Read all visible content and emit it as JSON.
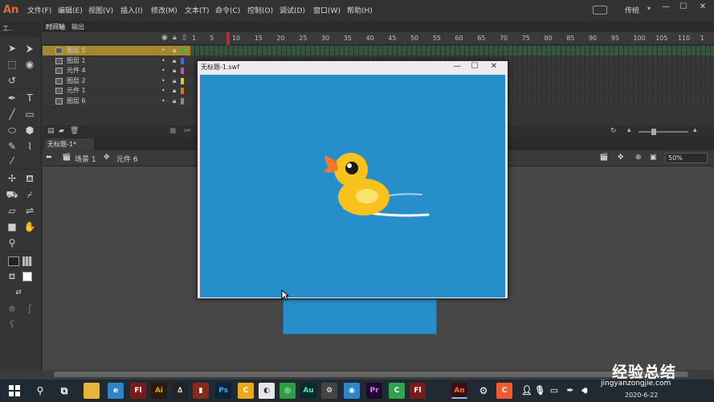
{
  "app": {
    "logo": "An",
    "workspace": "传统"
  },
  "menu": [
    "文件(F)",
    "编辑(E)",
    "视图(V)",
    "插入(I)",
    "修改(M)",
    "文本(T)",
    "命令(C)",
    "控制(O)",
    "调试(D)",
    "窗口(W)",
    "帮助(H)"
  ],
  "window_controls": [
    "—",
    "☐",
    "✕"
  ],
  "tools_header": "工..",
  "timeline": {
    "tabs": [
      "时间轴",
      "输出"
    ],
    "ruler": [
      "1",
      "5",
      "10",
      "15",
      "20",
      "25",
      "30",
      "35",
      "40",
      "45",
      "50",
      "55",
      "60",
      "65",
      "70",
      "75",
      "80",
      "85",
      "90",
      "95",
      "100",
      "105",
      "110",
      "1"
    ],
    "layers": [
      {
        "name": "图层 5",
        "color": "#2fb24e",
        "selected": true
      },
      {
        "name": "图层 1",
        "color": "#3a6fd8"
      },
      {
        "name": "元件 4",
        "color": "#c04fc0"
      },
      {
        "name": "图层 2",
        "color": "#d8c832"
      },
      {
        "name": "元件 1",
        "color": "#e07020"
      },
      {
        "name": "图层 6",
        "color": "#8a8a8a"
      }
    ]
  },
  "document": {
    "tab": "无标题-1*",
    "scene": "场景 1",
    "symbol": "元件 6",
    "zoom": "50%"
  },
  "swf": {
    "title": "无标题-1.swf",
    "controls": [
      "—",
      "☐",
      "✕"
    ]
  },
  "colors": {
    "stage": "#268ecb",
    "duck_body": "#f7c21b",
    "duck_beak": "#ee7a2a"
  },
  "taskbar": {
    "icons": [
      "Fl",
      "Ai",
      "Ps",
      "Au",
      "Pr",
      "Fl",
      "An"
    ],
    "date": "2020-6-22"
  },
  "watermark": {
    "line1": "经验总结",
    "line2": "jingyanzongjie.com"
  }
}
